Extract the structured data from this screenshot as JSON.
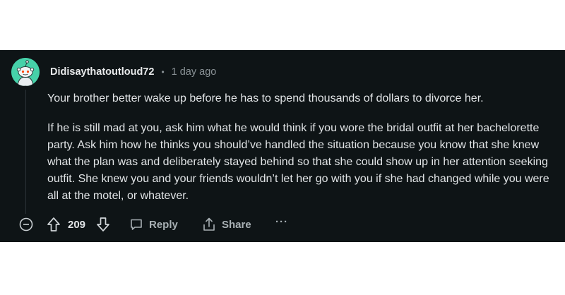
{
  "comment": {
    "username": "Didisaythatoutloud72",
    "separator": "•",
    "time": "1 day ago",
    "paragraphs": [
      "Your brother better wake up before he has to spend thousands of dollars to divorce her.",
      "If he is still mad at you, ask him what he would think if you wore the bridal outfit at her bachelorette party. Ask him how he thinks you should’ve handled the situation because you know that she knew what the plan was and deliberately stayed behind so that she could show up in her attention seeking outfit. She knew you and your friends wouldn’t let her go with you if she had changed while you were all at the motel, or whatever."
    ]
  },
  "actions": {
    "score": "209",
    "reply_label": "Reply",
    "share_label": "Share",
    "more_label": "···"
  },
  "icons": {
    "avatar": "reddit-snoo-avatar",
    "collapse": "minus-circle-icon",
    "upvote": "arrow-up-icon",
    "downvote": "arrow-down-icon",
    "reply": "comment-bubble-icon",
    "share": "share-icon",
    "more": "ellipsis-icon"
  },
  "colors": {
    "background": "#0e1416",
    "avatar": "#46d1a9",
    "text": "#e1e4e6",
    "muted": "#8a9296"
  }
}
